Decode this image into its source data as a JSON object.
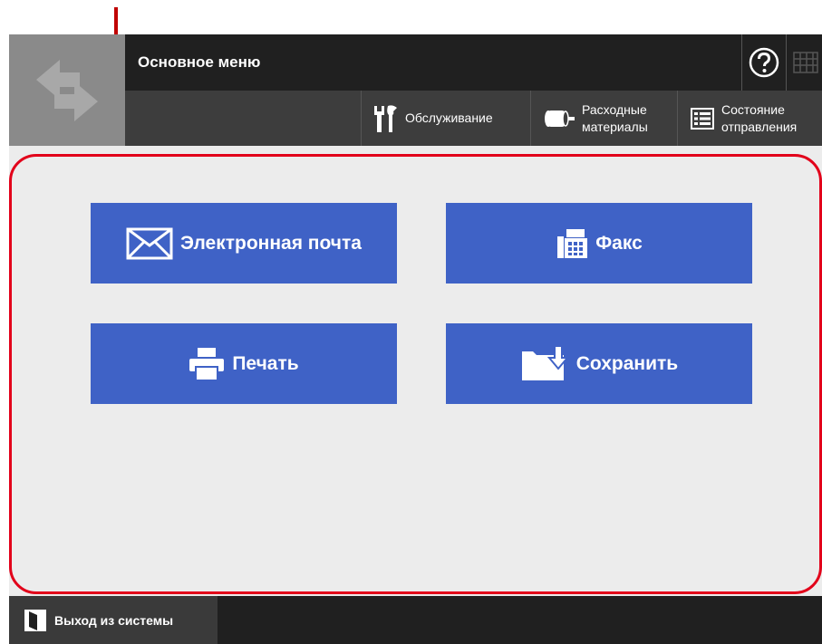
{
  "header": {
    "title": "Основное меню",
    "help_icon": "help-icon",
    "keyboard_icon": "keyboard-icon",
    "logo_icon": "swap-arrows-logo"
  },
  "toolbar": {
    "maintenance": {
      "label": "Обслуживание",
      "icon": "tools-icon"
    },
    "supplies": {
      "line1": "Расходные",
      "line2": "материалы",
      "icon": "roller-icon"
    },
    "status": {
      "line1": "Состояние",
      "line2": "отправления",
      "icon": "list-icon"
    }
  },
  "menu": {
    "email": "Электронная почта",
    "fax": "Факс",
    "print": "Печать",
    "save": "Сохранить"
  },
  "footer": {
    "logout": "Выход из системы"
  },
  "colors": {
    "tile": "#3f62c6",
    "header_dark": "#202020",
    "header_mid": "#3d3d3d",
    "content_bg": "#ececec",
    "highlight": "#e2001a"
  }
}
